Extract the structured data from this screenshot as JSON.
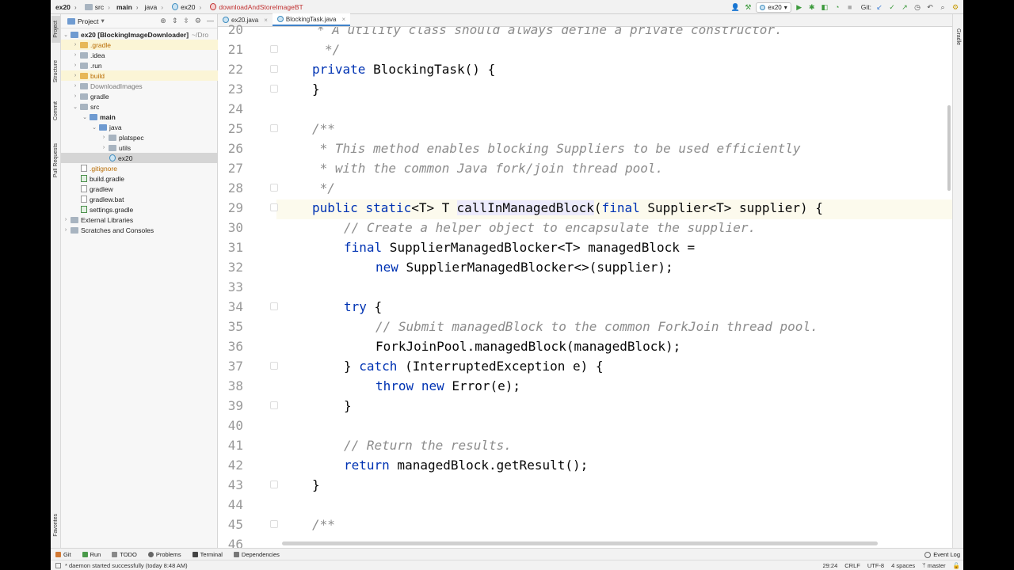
{
  "navbar": {
    "crumbs": [
      "ex20",
      "src",
      "main",
      "java",
      "ex20",
      "downloadAndStoreImageBT"
    ],
    "run_config": "ex20",
    "git_label": "Git:"
  },
  "left_strip": {
    "tabs": [
      "Project",
      "Structure",
      "Commit",
      "Pull Requests",
      "Favorites"
    ]
  },
  "right_strip": {
    "tabs": [
      "Gradle"
    ]
  },
  "project": {
    "title": "Project",
    "tree": [
      {
        "label": "ex20 [BlockingImageDownloader]",
        "extra": "~/Dro"
      },
      {
        "label": ".gradle"
      },
      {
        "label": ".idea"
      },
      {
        "label": ".run"
      },
      {
        "label": "build"
      },
      {
        "label": "DownloadImages"
      },
      {
        "label": "gradle"
      },
      {
        "label": "src"
      },
      {
        "label": "main"
      },
      {
        "label": "java"
      },
      {
        "label": "platspec"
      },
      {
        "label": "utils"
      },
      {
        "label": "ex20"
      },
      {
        "label": ".gitignore"
      },
      {
        "label": "build.gradle"
      },
      {
        "label": "gradlew"
      },
      {
        "label": "gradlew.bat"
      },
      {
        "label": "settings.gradle"
      },
      {
        "label": "External Libraries"
      },
      {
        "label": "Scratches and Consoles"
      }
    ]
  },
  "editor": {
    "tabs": [
      {
        "label": "ex20.java"
      },
      {
        "label": "BlockingTask.java"
      }
    ],
    "line_numbers": [
      "20",
      "21",
      "22",
      "23",
      "24",
      "25",
      "26",
      "27",
      "28",
      "29",
      "30",
      "31",
      "32",
      "33",
      "34",
      "35",
      "36",
      "37",
      "38",
      "39",
      "40",
      "41",
      "42",
      "43",
      "44",
      "45",
      "46"
    ],
    "code": {
      "l20": "* A utility class should always define a private constructor.",
      "l21": "*/",
      "l22_kw": "private",
      "l22_rest": " BlockingTask() {",
      "l23": "}",
      "l25": "/**",
      "l26": " * This method enables blocking Suppliers to be used efficiently",
      "l27": " * with the common Java fork/join thread pool.",
      "l28": " */",
      "l29_kw1": "public",
      "l29_kw2": "static",
      "l29_a": "<T> T ",
      "l29_method": "callInManagedBlock",
      "l29_b": "(",
      "l29_kw3": "final",
      "l29_c": " Supplier<T> supplier) {",
      "l30": "// Create a helper object to encapsulate the supplier.",
      "l31_kw": "final",
      "l31_rest": " SupplierManagedBlocker<T> managedBlock =",
      "l32_kw": "new",
      "l32_rest": " SupplierManagedBlocker<>(supplier);",
      "l34_kw": "try",
      "l34_rest": " {",
      "l35": "// Submit managedBlock to the common ForkJoin thread pool.",
      "l36": "ForkJoinPool.managedBlock(managedBlock);",
      "l37_a": "} ",
      "l37_kw": "catch",
      "l37_rest": " (InterruptedException e) {",
      "l38_kw1": "throw",
      "l38_kw2": "new",
      "l38_rest": " Error(e);",
      "l39": "}",
      "l41": "// Return the results.",
      "l42_kw": "return",
      "l42_rest": " managedBlock.getResult();",
      "l43": "}",
      "l45": "/**"
    }
  },
  "bottom_tools": [
    "Git",
    "Run",
    "TODO",
    "Problems",
    "Terminal",
    "Dependencies"
  ],
  "event_log": "Event Log",
  "status": {
    "message": "* daemon started successfully (today 8:48 AM)",
    "position": "29:24",
    "line_sep": "CRLF",
    "encoding": "UTF-8",
    "indent": "4 spaces",
    "branch": "master"
  }
}
